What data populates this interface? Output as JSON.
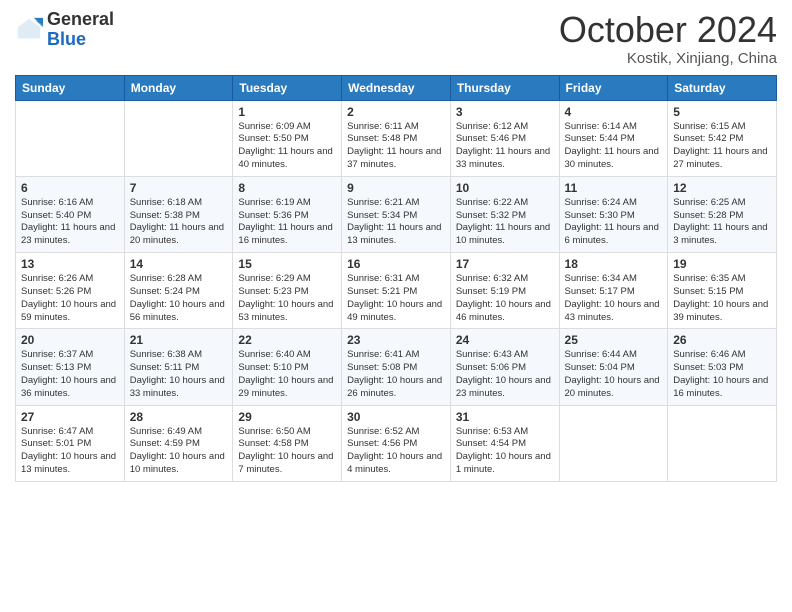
{
  "header": {
    "logo_general": "General",
    "logo_blue": "Blue",
    "month_title": "October 2024",
    "subtitle": "Kostik, Xinjiang, China"
  },
  "weekdays": [
    "Sunday",
    "Monday",
    "Tuesday",
    "Wednesday",
    "Thursday",
    "Friday",
    "Saturday"
  ],
  "weeks": [
    [
      {
        "day": "",
        "info": ""
      },
      {
        "day": "",
        "info": ""
      },
      {
        "day": "1",
        "info": "Sunrise: 6:09 AM\nSunset: 5:50 PM\nDaylight: 11 hours and 40 minutes."
      },
      {
        "day": "2",
        "info": "Sunrise: 6:11 AM\nSunset: 5:48 PM\nDaylight: 11 hours and 37 minutes."
      },
      {
        "day": "3",
        "info": "Sunrise: 6:12 AM\nSunset: 5:46 PM\nDaylight: 11 hours and 33 minutes."
      },
      {
        "day": "4",
        "info": "Sunrise: 6:14 AM\nSunset: 5:44 PM\nDaylight: 11 hours and 30 minutes."
      },
      {
        "day": "5",
        "info": "Sunrise: 6:15 AM\nSunset: 5:42 PM\nDaylight: 11 hours and 27 minutes."
      }
    ],
    [
      {
        "day": "6",
        "info": "Sunrise: 6:16 AM\nSunset: 5:40 PM\nDaylight: 11 hours and 23 minutes."
      },
      {
        "day": "7",
        "info": "Sunrise: 6:18 AM\nSunset: 5:38 PM\nDaylight: 11 hours and 20 minutes."
      },
      {
        "day": "8",
        "info": "Sunrise: 6:19 AM\nSunset: 5:36 PM\nDaylight: 11 hours and 16 minutes."
      },
      {
        "day": "9",
        "info": "Sunrise: 6:21 AM\nSunset: 5:34 PM\nDaylight: 11 hours and 13 minutes."
      },
      {
        "day": "10",
        "info": "Sunrise: 6:22 AM\nSunset: 5:32 PM\nDaylight: 11 hours and 10 minutes."
      },
      {
        "day": "11",
        "info": "Sunrise: 6:24 AM\nSunset: 5:30 PM\nDaylight: 11 hours and 6 minutes."
      },
      {
        "day": "12",
        "info": "Sunrise: 6:25 AM\nSunset: 5:28 PM\nDaylight: 11 hours and 3 minutes."
      }
    ],
    [
      {
        "day": "13",
        "info": "Sunrise: 6:26 AM\nSunset: 5:26 PM\nDaylight: 10 hours and 59 minutes."
      },
      {
        "day": "14",
        "info": "Sunrise: 6:28 AM\nSunset: 5:24 PM\nDaylight: 10 hours and 56 minutes."
      },
      {
        "day": "15",
        "info": "Sunrise: 6:29 AM\nSunset: 5:23 PM\nDaylight: 10 hours and 53 minutes."
      },
      {
        "day": "16",
        "info": "Sunrise: 6:31 AM\nSunset: 5:21 PM\nDaylight: 10 hours and 49 minutes."
      },
      {
        "day": "17",
        "info": "Sunrise: 6:32 AM\nSunset: 5:19 PM\nDaylight: 10 hours and 46 minutes."
      },
      {
        "day": "18",
        "info": "Sunrise: 6:34 AM\nSunset: 5:17 PM\nDaylight: 10 hours and 43 minutes."
      },
      {
        "day": "19",
        "info": "Sunrise: 6:35 AM\nSunset: 5:15 PM\nDaylight: 10 hours and 39 minutes."
      }
    ],
    [
      {
        "day": "20",
        "info": "Sunrise: 6:37 AM\nSunset: 5:13 PM\nDaylight: 10 hours and 36 minutes."
      },
      {
        "day": "21",
        "info": "Sunrise: 6:38 AM\nSunset: 5:11 PM\nDaylight: 10 hours and 33 minutes."
      },
      {
        "day": "22",
        "info": "Sunrise: 6:40 AM\nSunset: 5:10 PM\nDaylight: 10 hours and 29 minutes."
      },
      {
        "day": "23",
        "info": "Sunrise: 6:41 AM\nSunset: 5:08 PM\nDaylight: 10 hours and 26 minutes."
      },
      {
        "day": "24",
        "info": "Sunrise: 6:43 AM\nSunset: 5:06 PM\nDaylight: 10 hours and 23 minutes."
      },
      {
        "day": "25",
        "info": "Sunrise: 6:44 AM\nSunset: 5:04 PM\nDaylight: 10 hours and 20 minutes."
      },
      {
        "day": "26",
        "info": "Sunrise: 6:46 AM\nSunset: 5:03 PM\nDaylight: 10 hours and 16 minutes."
      }
    ],
    [
      {
        "day": "27",
        "info": "Sunrise: 6:47 AM\nSunset: 5:01 PM\nDaylight: 10 hours and 13 minutes."
      },
      {
        "day": "28",
        "info": "Sunrise: 6:49 AM\nSunset: 4:59 PM\nDaylight: 10 hours and 10 minutes."
      },
      {
        "day": "29",
        "info": "Sunrise: 6:50 AM\nSunset: 4:58 PM\nDaylight: 10 hours and 7 minutes."
      },
      {
        "day": "30",
        "info": "Sunrise: 6:52 AM\nSunset: 4:56 PM\nDaylight: 10 hours and 4 minutes."
      },
      {
        "day": "31",
        "info": "Sunrise: 6:53 AM\nSunset: 4:54 PM\nDaylight: 10 hours and 1 minute."
      },
      {
        "day": "",
        "info": ""
      },
      {
        "day": "",
        "info": ""
      }
    ]
  ]
}
